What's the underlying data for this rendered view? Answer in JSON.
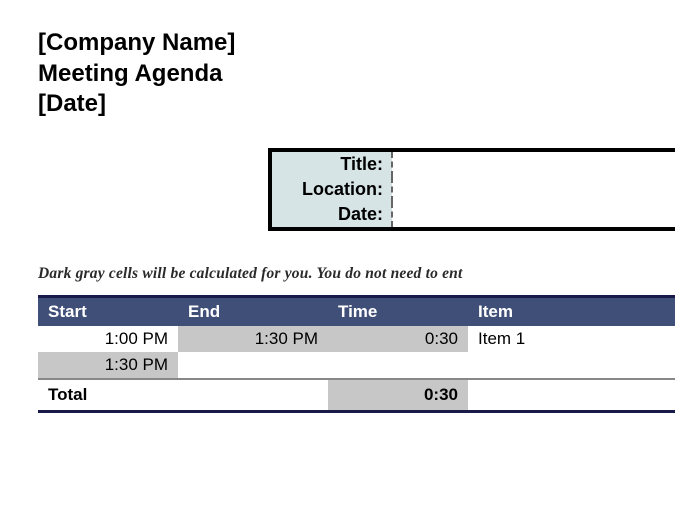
{
  "header": {
    "company": "[Company Name]",
    "title": "Meeting Agenda",
    "date": "[Date]"
  },
  "info": {
    "rows": [
      {
        "label": "Title:",
        "value": ""
      },
      {
        "label": "Location:",
        "value": ""
      },
      {
        "label": "Date:",
        "value": ""
      }
    ]
  },
  "note": "Dark gray cells will be calculated for you. You do not need to ent",
  "agenda": {
    "columns": {
      "start": "Start",
      "end": "End",
      "time": "Time",
      "item": "Item"
    },
    "rows": [
      {
        "start": "1:00 PM",
        "end": "1:30 PM",
        "time": "0:30",
        "item": "Item 1"
      },
      {
        "start": "1:30 PM",
        "end": "",
        "time": "",
        "item": ""
      }
    ],
    "total_label": "Total",
    "total_time": "0:30"
  }
}
